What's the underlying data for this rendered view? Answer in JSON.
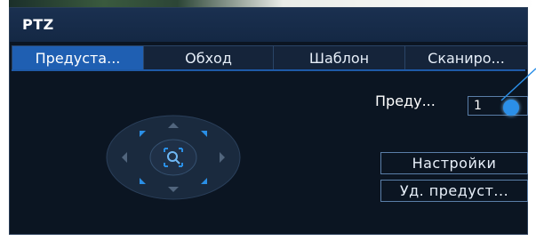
{
  "window": {
    "title": "PTZ"
  },
  "tabs": [
    {
      "label": "Предуста...",
      "active": true
    },
    {
      "label": "Обход",
      "active": false
    },
    {
      "label": "Шаблон",
      "active": false
    },
    {
      "label": "Сканиро...",
      "active": false
    }
  ],
  "preset": {
    "label": "Преду...",
    "value": "1"
  },
  "buttons": {
    "settings": "Настройки",
    "delete_preset": "Уд. предуст..."
  },
  "icons": {
    "joystick": "ptz-direction-pad-icon",
    "center": "zoom-magnifier-icon"
  },
  "colors": {
    "background": "#0b1522",
    "titlebar": "#142844",
    "tab_active": "#1f5fb2",
    "accent": "#2b8fe8"
  }
}
